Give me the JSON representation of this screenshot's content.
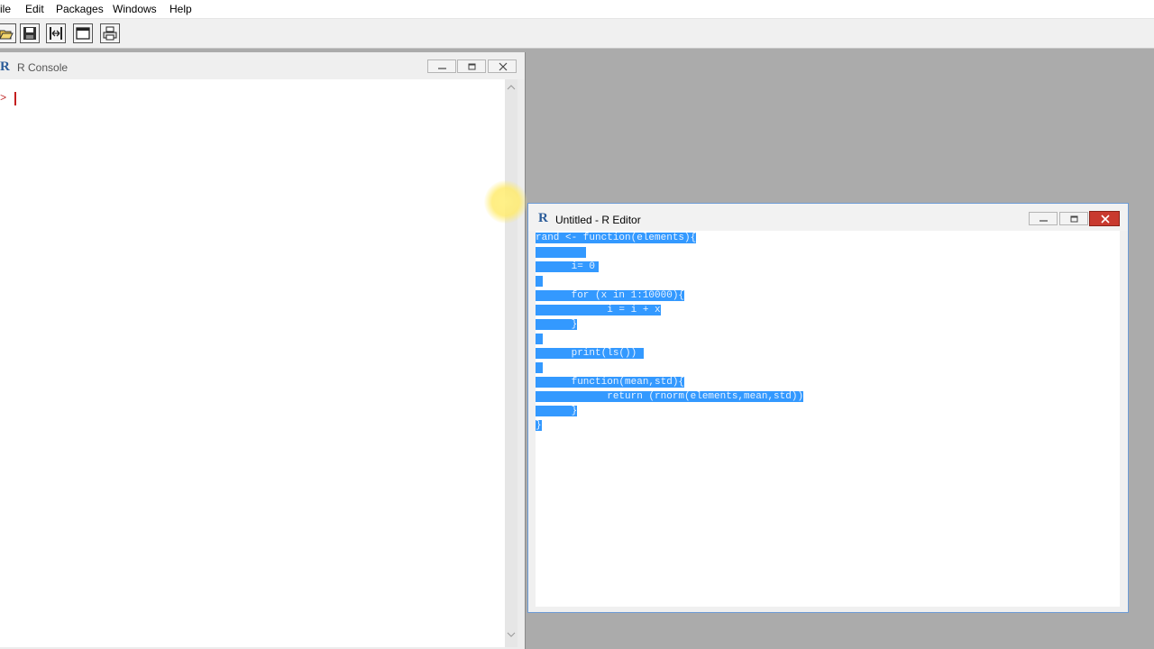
{
  "menubar": {
    "items": [
      "ile",
      "Edit",
      "Packages",
      "Windows",
      "Help"
    ]
  },
  "toolbar": {
    "buttons": [
      "open-script-icon",
      "save-icon",
      "resize-icon",
      "window-icon",
      "print-icon"
    ]
  },
  "console": {
    "title": "R Console",
    "prompt": ">"
  },
  "editor": {
    "title": "Untitled - R Editor",
    "lines": [
      "rand <- function(elements){",
      "",
      "      i= 0",
      "",
      "      for (x in 1:10000){",
      "            i = i + x",
      "      }",
      "",
      "      print(ls())",
      "",
      "      function(mean,std){",
      "            return (rnorm(elements,mean,std))",
      "      }",
      "}"
    ]
  },
  "colors": {
    "selection": "#3399ff",
    "close_button": "#c93a2f",
    "workspace": "#ababab"
  }
}
